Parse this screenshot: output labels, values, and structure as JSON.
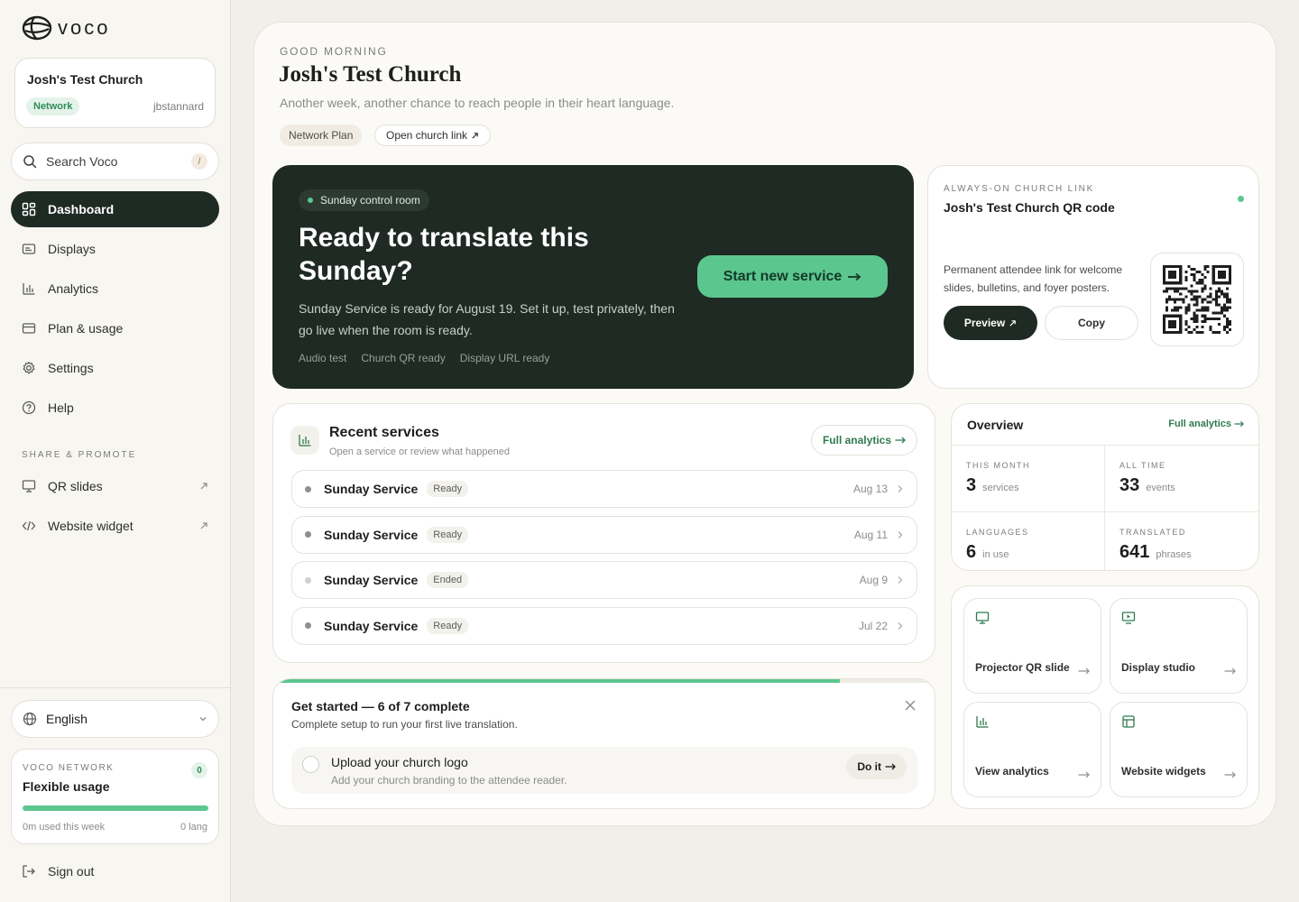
{
  "brand": {
    "name": "voco"
  },
  "sidebar": {
    "church": {
      "name": "Josh's Test Church",
      "plan_badge": "Network",
      "username": "jbstannard"
    },
    "search": {
      "label": "Search Voco",
      "shortcut": "/"
    },
    "nav": [
      {
        "label": "Dashboard",
        "icon": "dashboard-icon",
        "active": true
      },
      {
        "label": "Displays",
        "icon": "displays-icon"
      },
      {
        "label": "Analytics",
        "icon": "analytics-icon"
      },
      {
        "label": "Plan & usage",
        "icon": "card-icon"
      },
      {
        "label": "Settings",
        "icon": "gear-icon"
      },
      {
        "label": "Help",
        "icon": "help-icon"
      }
    ],
    "share_section_label": "SHARE & PROMOTE",
    "share_nav": [
      {
        "label": "QR slides",
        "icon": "presentation-icon"
      },
      {
        "label": "Website widget",
        "icon": "code-icon"
      }
    ],
    "language": "English",
    "usage": {
      "label": "VOCO NETWORK",
      "badge": "0",
      "title": "Flexible usage",
      "progress_percent": 100,
      "used": "0m used this week",
      "languages": "0 lang"
    },
    "signout": "Sign out"
  },
  "header": {
    "greeting": "GOOD MORNING",
    "title": "Josh's Test Church",
    "subtitle": "Another week, another chance to reach people in their heart language.",
    "plan_chip": "Network Plan",
    "link_chip": "Open church link"
  },
  "hero": {
    "pill": "Sunday control room",
    "title": "Ready to translate this Sunday?",
    "description": "Sunday Service is ready for August 19. Set it up, test privately, then go live when the room is ready.",
    "tags": [
      "Audio test",
      "Church QR ready",
      "Display URL ready"
    ],
    "cta": "Start new service"
  },
  "qr_card": {
    "label": "ALWAYS-ON CHURCH LINK",
    "title": "Josh's Test Church QR code",
    "description": "Permanent attendee link for welcome slides, bulletins, and foyer posters.",
    "preview": "Preview",
    "copy": "Copy"
  },
  "recent": {
    "title": "Recent services",
    "subtitle": "Open a service or review what happened",
    "full_analytics": "Full analytics",
    "services": [
      {
        "name": "Sunday Service",
        "status": "Ready",
        "date": "Aug 13"
      },
      {
        "name": "Sunday Service",
        "status": "Ready",
        "date": "Aug 11"
      },
      {
        "name": "Sunday Service",
        "status": "Ended",
        "date": "Aug 9"
      },
      {
        "name": "Sunday Service",
        "status": "Ready",
        "date": "Jul 22"
      }
    ]
  },
  "get_started": {
    "title": "Get started — 6 of 7 complete",
    "subtitle": "Complete setup to run your first live translation.",
    "completed": 6,
    "total": 7,
    "task": {
      "title": "Upload your church logo",
      "subtitle": "Add your church branding to the attendee reader.",
      "action": "Do it"
    }
  },
  "overview": {
    "title": "Overview",
    "link": "Full analytics",
    "stats": [
      {
        "label": "THIS MONTH",
        "value": "3",
        "unit": "services"
      },
      {
        "label": "ALL TIME",
        "value": "33",
        "unit": "events"
      },
      {
        "label": "LANGUAGES",
        "value": "6",
        "unit": "in use"
      },
      {
        "label": "TRANSLATED",
        "value": "641",
        "unit": "phrases"
      }
    ]
  },
  "quick_actions": [
    {
      "label": "Projector QR slide",
      "icon": "presentation-icon"
    },
    {
      "label": "Display studio",
      "icon": "monitor-icon"
    },
    {
      "label": "View analytics",
      "icon": "analytics-icon"
    },
    {
      "label": "Website widgets",
      "icon": "layout-icon"
    }
  ],
  "colors": {
    "accent": "#5cc68f",
    "dark": "#1e2a23",
    "background": "#f1efea"
  }
}
